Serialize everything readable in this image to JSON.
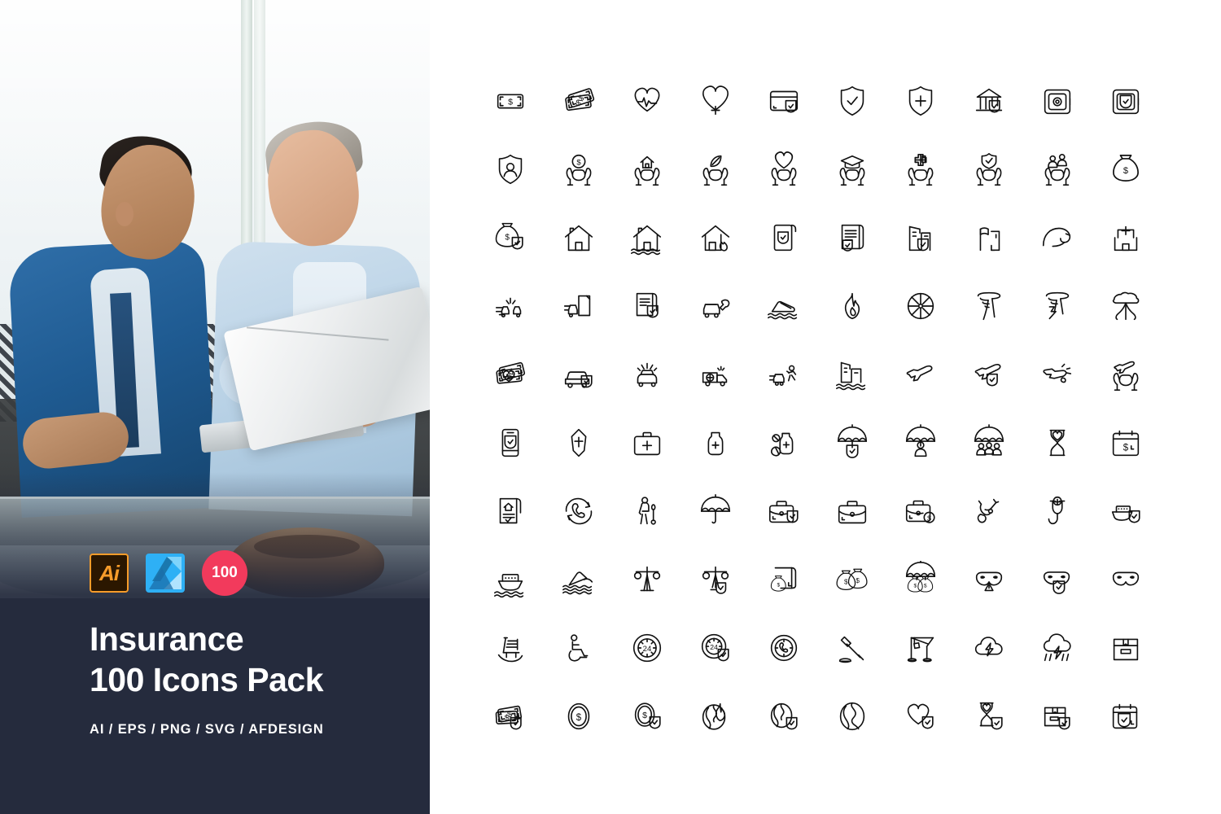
{
  "left_panel": {
    "badges": [
      {
        "name": "adobe-illustrator-badge",
        "label": "Ai"
      },
      {
        "name": "affinity-designer-badge",
        "label": ""
      },
      {
        "name": "icon-count-badge",
        "label": "100"
      }
    ],
    "title_line1": "Insurance",
    "title_line2": "100 Icons Pack",
    "formats": "AI / EPS / PNG / SVG / AFDESIGN",
    "colors": {
      "panel_bg": "#252b3d",
      "accent_pink": "#f23a5c",
      "illustrator_orange": "#f79c2a",
      "illustrator_dark": "#2b1700",
      "affinity_blue": "#2eb0f5",
      "text": "#ffffff"
    },
    "photo_alt": "Two businessmen sitting on a sofa smiling at a laptop by a window"
  },
  "icon_grid": {
    "columns": 10,
    "rows": 10,
    "total": 100,
    "stroke_color": "#111111",
    "icons": [
      "banknote-dollar-icon",
      "banknotes-stack-icon",
      "heart-pulse-icon",
      "heart-life-icon",
      "credit-card-shield-icon",
      "shield-check-icon",
      "shield-medical-icon",
      "bank-shield-icon",
      "safe-vault-icon",
      "safe-shield-icon",
      "shield-user-icon",
      "hands-coin-icon",
      "hands-home-icon",
      "hands-leaf-icon",
      "hands-heart-icon",
      "hands-graduation-icon",
      "hands-medical-icon",
      "hands-shield-icon",
      "hands-family-icon",
      "money-bag-icon",
      "money-bag-shield-icon",
      "house-icon",
      "house-flood-icon",
      "house-fire-icon",
      "document-shield-icon",
      "contract-shield-icon",
      "building-shield-icon",
      "buildings-flag-icon",
      "tsunami-wave-icon",
      "hospital-icon",
      "car-crash-icon",
      "car-document-icon",
      "policy-document-shield-icon",
      "car-repair-icon",
      "car-submerged-icon",
      "fire-flame-icon",
      "hurricane-icon",
      "tornado-icon",
      "tornado-lightning-icon",
      "nuclear-explosion-icon",
      "cash-health-icon",
      "car-shield-icon",
      "car-collision-icon",
      "ambulance-icon",
      "car-pedestrian-accident-icon",
      "building-flood-icon",
      "airplane-icon",
      "airplane-shield-icon",
      "airplane-crash-icon",
      "hands-airplane-icon",
      "mobile-shield-icon",
      "coffin-icon",
      "first-aid-kit-icon",
      "medicine-bottle-icon",
      "medicine-pills-icon",
      "umbrella-shield-icon",
      "umbrella-person-icon",
      "umbrella-family-icon",
      "hourglass-heart-icon",
      "calendar-dollar-icon",
      "home-policy-document-icon",
      "phone-support-icon",
      "elderly-care-icon",
      "umbrella-icon",
      "briefcase-shield-icon",
      "briefcase-icon",
      "briefcase-dollar-icon",
      "stethoscope-icon",
      "stethoscope-medical-icon",
      "ship-shield-icon",
      "ship-icon",
      "ship-sinking-icon",
      "scales-justice-icon",
      "scales-shield-icon",
      "money-document-icon",
      "money-bags-icon",
      "umbrella-money-bags-icon",
      "fraud-mask-alert-icon",
      "fraud-mask-shield-icon",
      "mask-icon",
      "rocking-chair-icon",
      "wheelchair-icon",
      "24-hours-icon",
      "24-hours-shield-icon",
      "clock-support-icon",
      "gavel-icon",
      "crane-icon",
      "cloud-lightning-icon",
      "storm-rain-icon",
      "package-box-icon",
      "cash-shield-icon",
      "coin-dollar-icon",
      "coin-shield-icon",
      "globe-fire-icon",
      "globe-shield-icon",
      "globe-icon",
      "heart-shield-icon",
      "hourglass-shield-icon",
      "package-shield-icon",
      "calendar-shield-icon"
    ]
  }
}
